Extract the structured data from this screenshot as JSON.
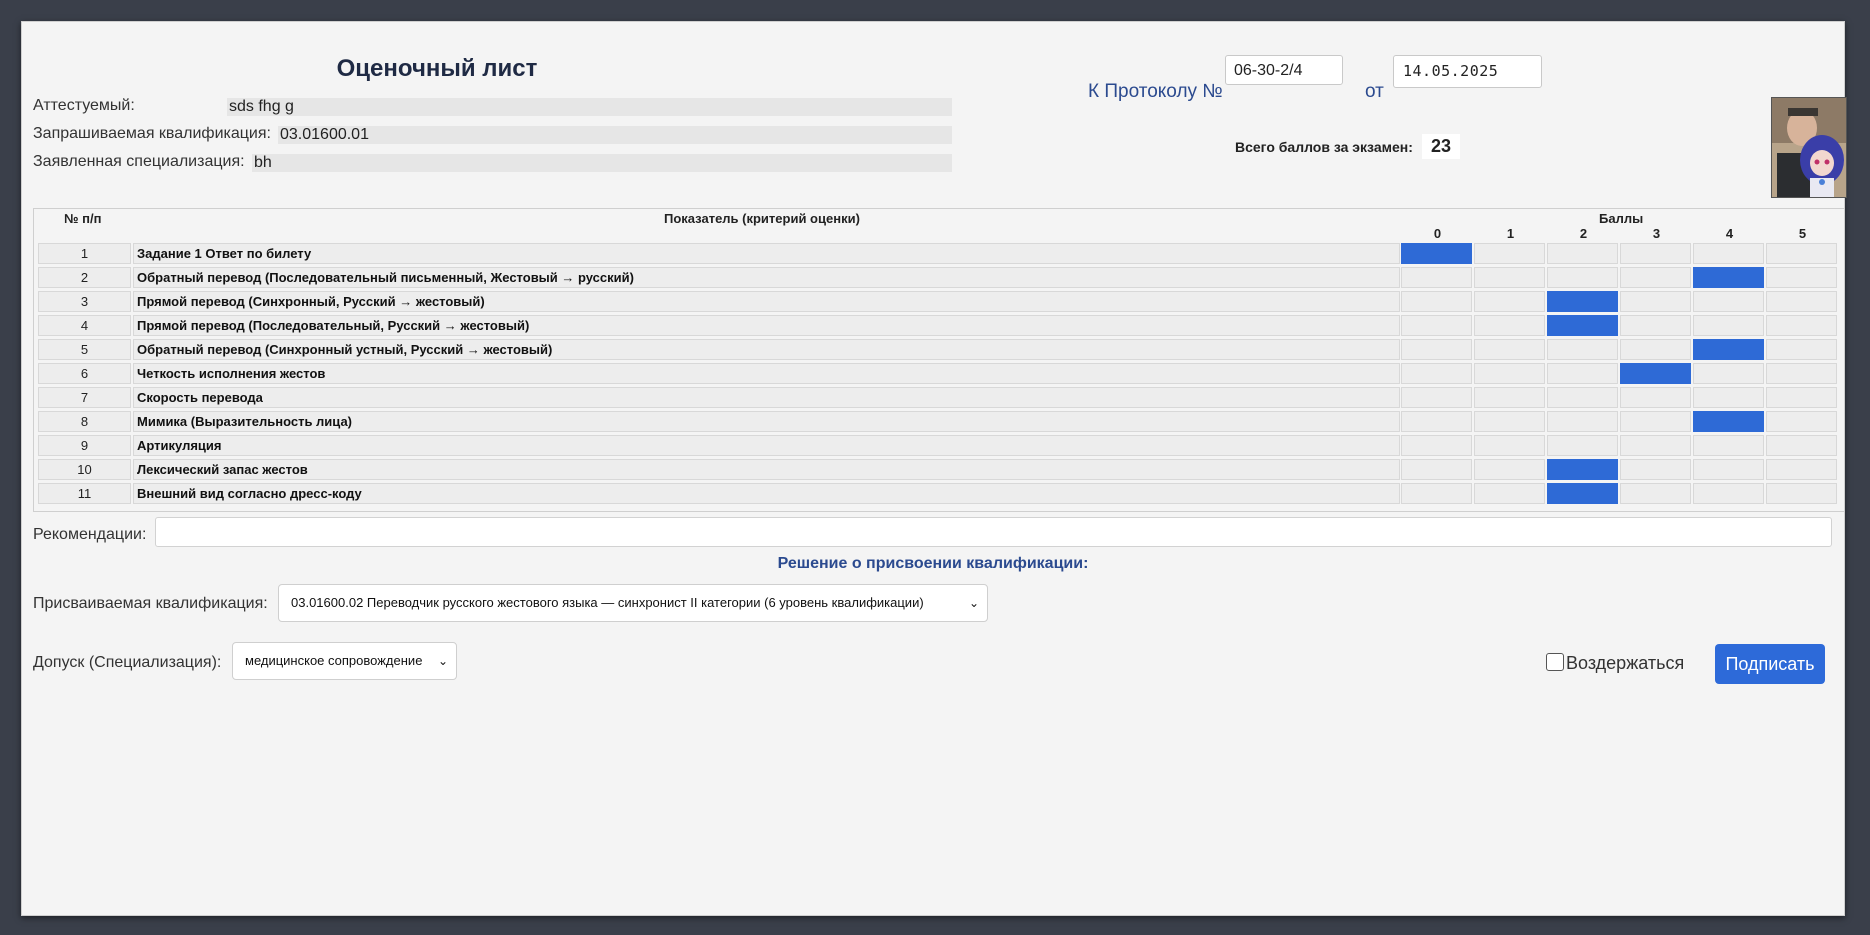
{
  "header": {
    "title": "Оценочный лист",
    "protocol_label": "К Протоколу №",
    "protocol_number": "06-30-2/4",
    "from_label": "от",
    "protocol_date": "14.05.2025"
  },
  "candidate": {
    "name_label": "Аттестуемый:",
    "name_value": "sds fhg g",
    "qualification_label": "Запрашиваемая квалификация:",
    "qualification_value": "03.01600.01",
    "specialization_label": "Заявленная специализация:",
    "specialization_value": "bh"
  },
  "total": {
    "label": "Всего баллов за экзамен:",
    "value": "23"
  },
  "table": {
    "col_num": "№ п/п",
    "col_criterion": "Показатель (критерий оценки)",
    "col_scores": "Баллы",
    "score_values": [
      "0",
      "1",
      "2",
      "3",
      "4",
      "5"
    ],
    "rows": [
      {
        "num": "1",
        "criterion": "Задание 1 Ответ по билету",
        "score": 0
      },
      {
        "num": "2",
        "criterion": "Обратный перевод (Последовательный письменный, Жестовый → русский)",
        "score": 4
      },
      {
        "num": "3",
        "criterion": "Прямой перевод (Синхронный, Русский → жестовый)",
        "score": 2
      },
      {
        "num": "4",
        "criterion": "Прямой перевод (Последовательный, Русский → жестовый)",
        "score": 2
      },
      {
        "num": "5",
        "criterion": "Обратный перевод (Синхронный устный, Русский → жестовый)",
        "score": 4
      },
      {
        "num": "6",
        "criterion": "Четкость исполнения жестов",
        "score": 3
      },
      {
        "num": "7",
        "criterion": "Скорость перевода",
        "score": null
      },
      {
        "num": "8",
        "criterion": "Мимика (Выразительность лица)",
        "score": 4
      },
      {
        "num": "9",
        "criterion": "Артикуляция",
        "score": null
      },
      {
        "num": "10",
        "criterion": "Лексический запас жестов",
        "score": 2
      },
      {
        "num": "11",
        "criterion": "Внешний вид согласно дресс-коду",
        "score": 2
      }
    ]
  },
  "recommendations": {
    "label": "Рекомендации:",
    "value": ""
  },
  "decision": {
    "heading": "Решение о присвоении квалификации:",
    "assign_label": "Присваиваемая квалификация:",
    "assign_value": "03.01600.02 Переводчик русского жестового языка — синхронист II категории (6 уровень квалификации)",
    "admission_label": "Допуск (Специализация):",
    "admission_value": "медицинское сопровождение",
    "abstain_label": "Воздержаться",
    "sign_label": "Подписать"
  },
  "colors": {
    "accent": "#2e6ad6",
    "heading": "#2b4a8f"
  }
}
